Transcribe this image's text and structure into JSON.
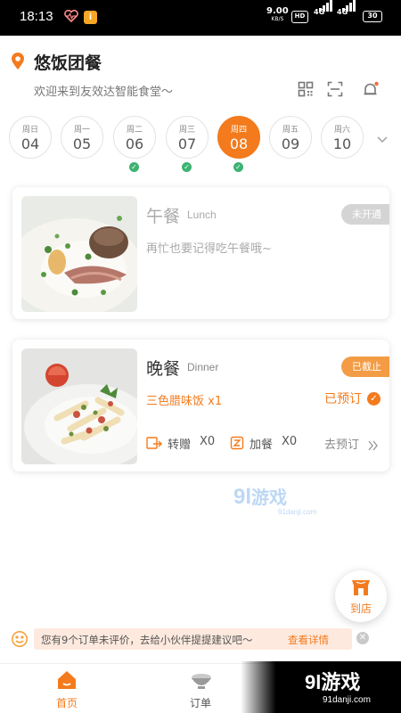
{
  "status_bar": {
    "time": "18:13",
    "net_speed": "9.00",
    "net_speed_unit": "KB/S",
    "hd": "HD",
    "net1": "4G",
    "net2": "4G",
    "battery": "30",
    "app_badge": "i"
  },
  "header": {
    "title": "悠饭团餐",
    "welcome": "欢迎来到友效达智能食堂～",
    "icons": [
      "location-icon",
      "qr-code-icon",
      "scan-icon",
      "bell-icon"
    ],
    "has_notification_dot": true
  },
  "week": {
    "days": [
      {
        "weekday": "周日",
        "date": "04",
        "active": false,
        "ordered": false
      },
      {
        "weekday": "周一",
        "date": "05",
        "active": false,
        "ordered": false
      },
      {
        "weekday": "周二",
        "date": "06",
        "active": false,
        "ordered": true
      },
      {
        "weekday": "周三",
        "date": "07",
        "active": false,
        "ordered": true
      },
      {
        "weekday": "周四",
        "date": "08",
        "active": true,
        "ordered": true
      },
      {
        "weekday": "周五",
        "date": "09",
        "active": false,
        "ordered": false
      },
      {
        "weekday": "周六",
        "date": "10",
        "active": false,
        "ordered": false
      }
    ]
  },
  "meals": {
    "lunch": {
      "name": "午餐",
      "name_en": "Lunch",
      "status": "未开通",
      "reminder": "再忙也要记得吃午餐哦~"
    },
    "dinner": {
      "name": "晚餐",
      "name_en": "Dinner",
      "status": "已截止",
      "dish": "三色腊味饭 x1",
      "ordered_label": "已预订",
      "transfer_label": "转赠",
      "transfer_count": "X0",
      "add_label": "加餐",
      "add_count": "X0",
      "goto_label": "去预订"
    }
  },
  "store_button": {
    "label": "到店"
  },
  "notice": {
    "text": "您有9个订单未评价，去给小伙伴提提建议吧～",
    "link": "查看详情"
  },
  "tabs": [
    {
      "label": "首页",
      "icon": "home-icon",
      "active": true
    },
    {
      "label": "订单",
      "icon": "bowl-icon",
      "active": false
    }
  ],
  "watermarks": {
    "mid_brand": "9",
    "mid_brand_b": "l",
    "mid_brand_cn": "游戏",
    "mid_sub": "91danji.com",
    "corner_brand": "9l游戏",
    "corner_sub": "91danji.com"
  },
  "colors": {
    "accent": "#f37b1d",
    "ordered_check": "#3cb371",
    "closed_badge": "#d4d4d4",
    "deadline_badge": "#f39c45",
    "notice_bg": "#fde9de"
  }
}
